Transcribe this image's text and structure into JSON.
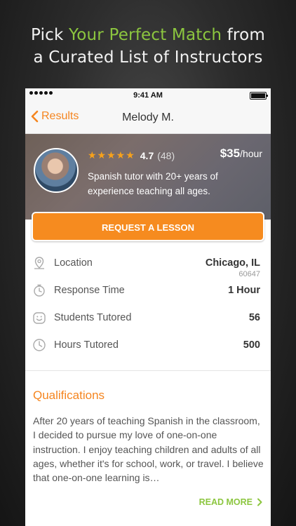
{
  "headline": {
    "line1_before": "Pick ",
    "line1_accent": "Your Perfect Match",
    "line1_after": " from",
    "line2": "a Curated List of Instructors"
  },
  "status_bar": {
    "time": "9:41 AM"
  },
  "nav": {
    "back_label": "Results",
    "title": "Melody M."
  },
  "profile": {
    "stars": "★★★★★",
    "rating": "4.7",
    "review_count": "(48)",
    "price": "$35",
    "price_unit": "/hour",
    "bio": "Spanish tutor with 20+ years of experience teaching all ages."
  },
  "cta_label": "REQUEST A LESSON",
  "stats": [
    {
      "label": "Location",
      "value": "Chicago, IL",
      "sub": "60647",
      "icon": "location-pin-icon"
    },
    {
      "label": "Response Time",
      "value": "1 Hour",
      "icon": "stopwatch-icon"
    },
    {
      "label": "Students Tutored",
      "value": "56",
      "icon": "smiley-icon"
    },
    {
      "label": "Hours Tutored",
      "value": "500",
      "icon": "clock-icon"
    }
  ],
  "qualifications": {
    "title": "Qualifications",
    "text": "After 20 years of teaching Spanish in the classroom, I decided to pursue my love of one-on-one instruction. I enjoy teaching children and adults of all ages, whether it's for school, work, or travel. I believe that one-on-one learning is…",
    "read_more": "READ MORE"
  },
  "colors": {
    "accent_orange": "#f5851f",
    "accent_green": "#8cc63f"
  }
}
